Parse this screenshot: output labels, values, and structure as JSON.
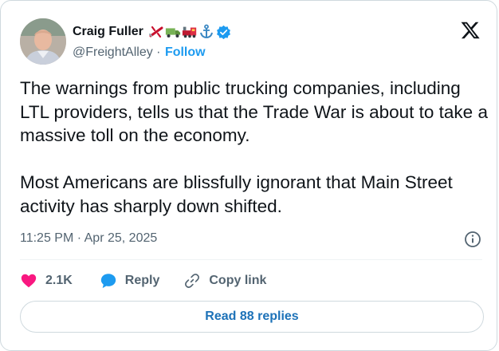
{
  "author": {
    "display_name": "Craig Fuller",
    "handle": "@FreightAlley",
    "separator": " · ",
    "follow_label": "Follow",
    "badge_emojis": [
      "airplane-emoji",
      "truck-emoji",
      "locomotive-emoji",
      "anchor-emoji"
    ],
    "verified": true
  },
  "tweet": {
    "text": "The warnings from public trucking companies, including LTL providers, tells us that the Trade War is about to take a massive toll on the economy.\n\nMost Americans are blissfully ignorant that Main Street activity has sharply down shifted.",
    "timestamp": "11:25 PM · Apr 25, 2025"
  },
  "actions": {
    "likes": "2.1K",
    "reply_label": "Reply",
    "copy_link_label": "Copy link"
  },
  "replies_button": "Read 88 replies",
  "colors": {
    "accent": "#1d9bf0",
    "like": "#f91880",
    "text": "#0f1419",
    "muted": "#536471"
  }
}
